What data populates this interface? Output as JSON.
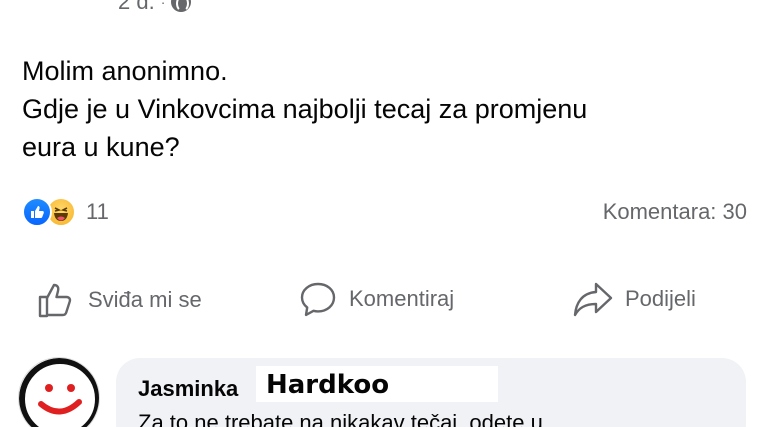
{
  "post": {
    "timestamp": "2 d.",
    "separator": "·",
    "privacy_icon": "globe-icon",
    "text_line1": "Molim anonimno.",
    "text_line2": "Gdje je u Vinkovcima najbolji tecaj za promjenu",
    "text_line3": "eura u kune?"
  },
  "reactions": {
    "icons": [
      "like-icon",
      "haha-icon"
    ],
    "count": "11",
    "comments": "Komentara: 30"
  },
  "actions": {
    "like_label": "Sviđa mi se",
    "comment_label": "Komentiraj",
    "share_label": "Podijeli"
  },
  "comment": {
    "author_first": "Jasminka",
    "author_overlay": "Hardkoo",
    "text": "Za to ne trebate na nikakav tečaj, odete u"
  },
  "colors": {
    "accent_blue": "#0866ff",
    "secondary_text": "#65676b",
    "comment_bg": "#f0f2f5",
    "avatar_red": "#e02020"
  }
}
